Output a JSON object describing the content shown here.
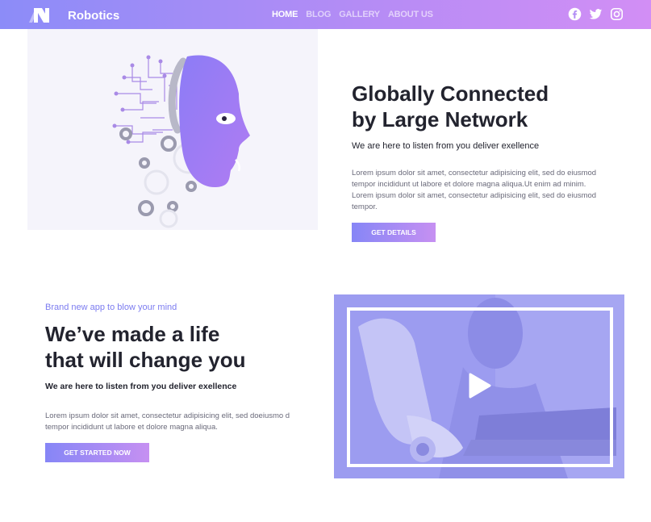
{
  "brand": {
    "name": "Robotics",
    "logo_icon": "robotics-logo-icon"
  },
  "nav": {
    "items": [
      {
        "label": "HOME",
        "active": true
      },
      {
        "label": "BLOG",
        "active": false
      },
      {
        "label": "GALLERY",
        "active": false
      },
      {
        "label": "ABOUT US",
        "active": false
      }
    ]
  },
  "social": [
    "facebook-icon",
    "twitter-icon",
    "instagram-icon"
  ],
  "section1": {
    "illustration": "robot-head-illustration",
    "title_line1": "Globally Connected",
    "title_line2": "by Large Network",
    "subtitle": "We are here to listen from you deliver exellence",
    "paragraph": "Lorem ipsum dolor sit amet, consectetur adipisicing elit, sed do eiusmod tempor incididunt ut labore et dolore magna aliqua.Ut enim ad minim. Lorem ipsum dolor sit amet, consectetur adipisicing elit, sed do eiusmod tempor.",
    "button_label": "GET DETAILS"
  },
  "section2": {
    "eyebrow": "Brand new app to blow your mind",
    "title_line1": "We’ve made a life",
    "title_line2": "that will change you",
    "subtitle": "We are here to listen from you deliver exellence",
    "paragraph": "Lorem ipsum dolor sit amet, consectetur adipisicing elit, sed doeiusmo d tempor incididunt ut labore et dolore magna aliqua.",
    "button_label": "GET STARTED NOW",
    "video": {
      "thumbnail": "man-with-robot-arm-photo",
      "play_icon": "play-icon"
    }
  },
  "colors": {
    "accent_start": "#8686f6",
    "accent_end": "#c690f2",
    "video_tint": "#9c9cf0"
  }
}
